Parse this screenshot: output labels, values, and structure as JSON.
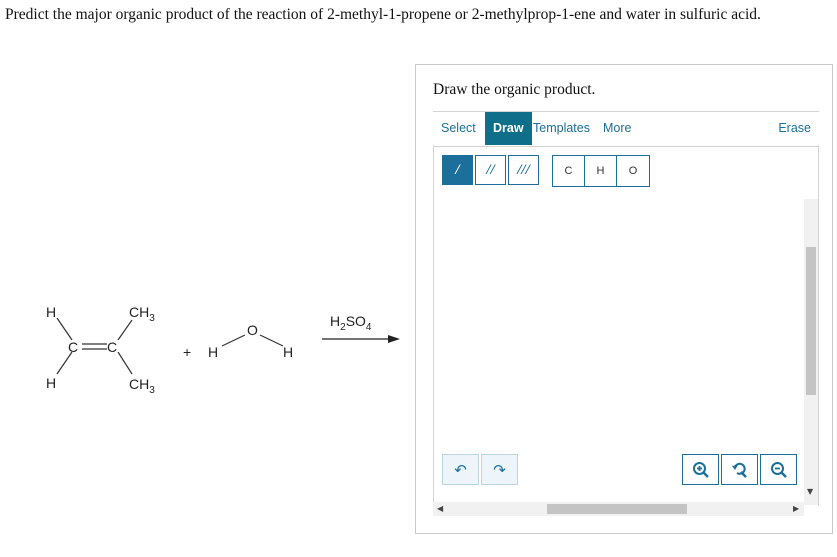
{
  "question": "Predict the major organic product of the reaction of 2-methyl-1-propene or 2-methylprop-1-ene and water in sulfuric acid.",
  "scheme": {
    "h_top": "H",
    "h_bottom": "H",
    "c_left": "C",
    "c_right": "C",
    "ch3_top": "CH",
    "ch3_top_sub": "3",
    "ch3_bottom": "CH",
    "ch3_bottom_sub": "3",
    "plus": "+",
    "water_h_left": "H",
    "water_o": "O",
    "water_h_right": "H",
    "reagent_h": "H",
    "reagent_h_sub": "2",
    "reagent_so": "SO",
    "reagent_so_sub": "4"
  },
  "panel": {
    "title": "Draw the organic product.",
    "tabs": [
      "Select",
      "Draw",
      "Templates",
      "More"
    ],
    "active_tab": "Draw",
    "erase_label": "Erase",
    "bond_tools": [
      "/",
      "//",
      "///"
    ],
    "atom_tools": [
      "C",
      "H",
      "O"
    ],
    "undo_icon": "undo-icon",
    "redo_icon": "redo-icon",
    "zoom_icons": [
      "zoom-in-icon",
      "zoom-reset-icon",
      "zoom-out-icon"
    ]
  },
  "colors": {
    "accent": "#0f6e8a",
    "link": "#1b6f9a"
  }
}
